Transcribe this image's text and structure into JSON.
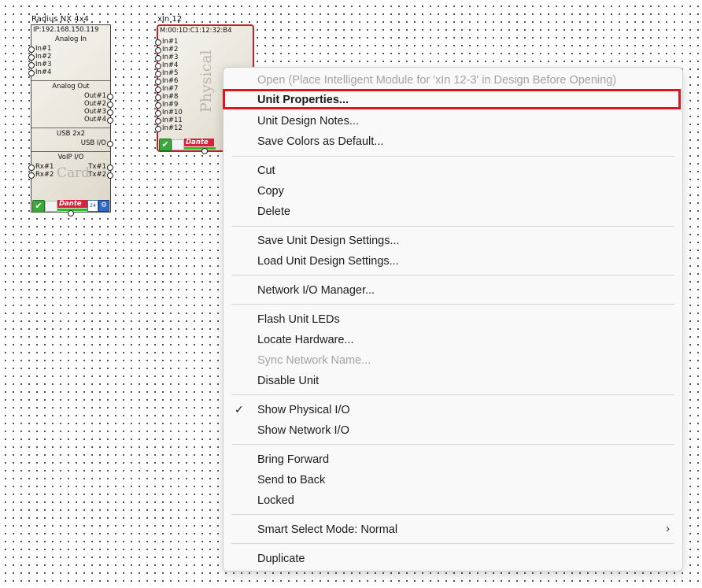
{
  "unit1": {
    "title": "Radius NX 4x4",
    "ip": "IP:192.168.150.119",
    "analog_in_title": "Analog In",
    "analog_in_ports": [
      "In#1",
      "In#2",
      "In#3",
      "In#4"
    ],
    "analog_out_title": "Analog Out",
    "analog_out_ports": [
      "Out#1",
      "Out#2",
      "Out#3",
      "Out#4"
    ],
    "usb_title": "USB 2x2",
    "usb_port": "USB I/O",
    "voip_title": "VoIP I/O",
    "voip_rx": [
      "Rx#1",
      "Rx#2"
    ],
    "voip_tx": [
      "Tx#1",
      "Tx#2"
    ],
    "watermark": "Card",
    "dante_label": "Dante",
    "calendar_text": "24"
  },
  "unit2": {
    "title": "xIn 12",
    "mac": "M:00:1D:C1:12:32:B4",
    "ports": [
      "In#1",
      "In#2",
      "In#3",
      "In#4",
      "In#5",
      "In#6",
      "In#7",
      "In#8",
      "In#9",
      "In#10",
      "In#11",
      "In#12"
    ],
    "watermark": "Physical",
    "dante_label": "Dante"
  },
  "menu": {
    "open_label": "Open (Place Intelligent Module for 'xIn 12-3' in Design Before Opening)",
    "unit_properties_label": "Unit Properties...",
    "unit_design_notes_label": "Unit Design Notes...",
    "save_colors_label": "Save Colors as Default...",
    "cut_label": "Cut",
    "copy_label": "Copy",
    "delete_label": "Delete",
    "save_settings_label": "Save Unit Design Settings...",
    "load_settings_label": "Load Unit Design Settings...",
    "network_io_manager_label": "Network I/O Manager...",
    "flash_leds_label": "Flash Unit LEDs",
    "locate_hardware_label": "Locate Hardware...",
    "sync_network_name_label": "Sync Network Name...",
    "disable_unit_label": "Disable Unit",
    "show_physical_io_label": "Show Physical I/O",
    "show_network_io_label": "Show Network I/O",
    "bring_forward_label": "Bring Forward",
    "send_to_back_label": "Send to Back",
    "locked_label": "Locked",
    "smart_select_label": "Smart Select Mode: Normal",
    "duplicate_label": "Duplicate",
    "highlight_color": "#e0141e"
  }
}
